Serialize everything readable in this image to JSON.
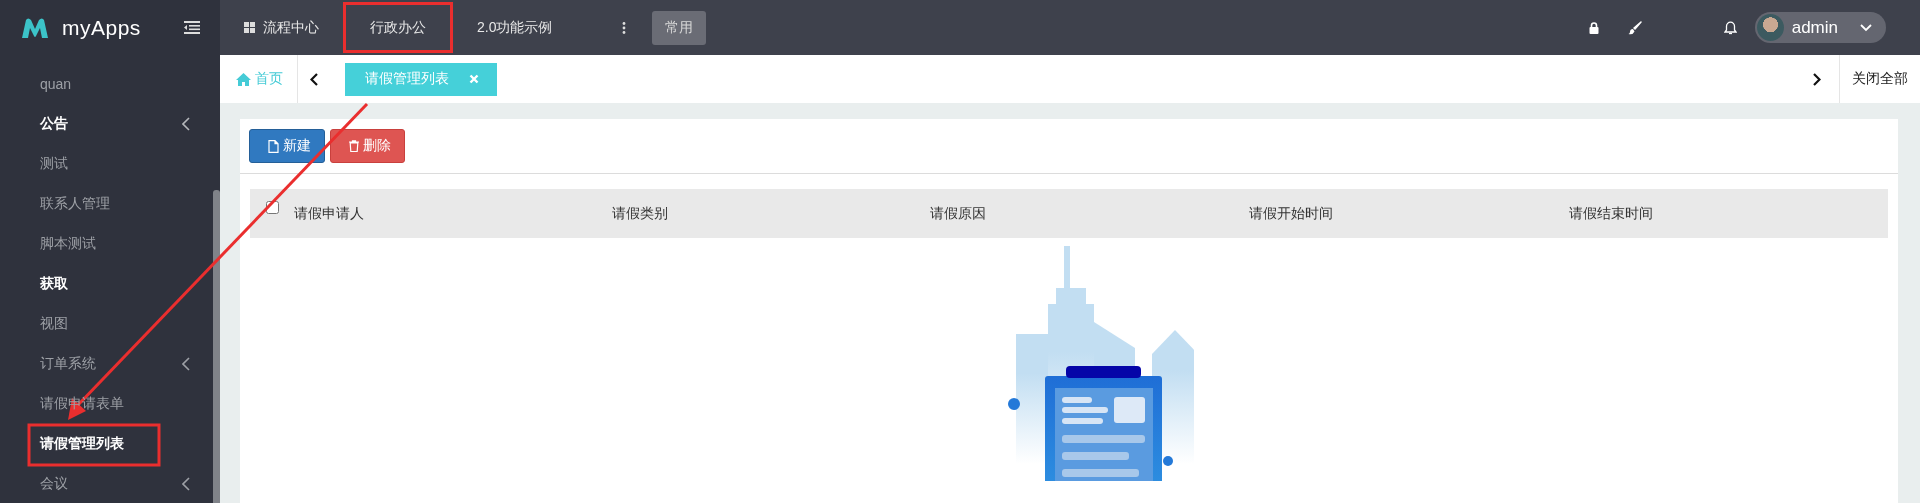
{
  "brand": {
    "name": "myApps"
  },
  "top_nav": [
    {
      "label": "流程中心",
      "kind": "grid",
      "selected": false
    },
    {
      "label": "行政办公",
      "kind": "plain",
      "selected": true
    },
    {
      "label": "2.0功能示例",
      "kind": "plain",
      "selected": false
    }
  ],
  "common_button": "常用",
  "user": {
    "name": "admin"
  },
  "sidebar": {
    "items": [
      {
        "label": "quan",
        "kind": "item",
        "highlighted": false
      },
      {
        "label": "公告",
        "kind": "group",
        "highlighted": true
      },
      {
        "label": "测试",
        "kind": "item",
        "highlighted": false
      },
      {
        "label": "联系人管理",
        "kind": "item",
        "highlighted": false
      },
      {
        "label": "脚本测试",
        "kind": "item",
        "highlighted": false
      },
      {
        "label": "获取",
        "kind": "item",
        "highlighted": true
      },
      {
        "label": "视图",
        "kind": "item",
        "highlighted": false
      },
      {
        "label": "订单系统",
        "kind": "group",
        "highlighted": false
      },
      {
        "label": "请假申请表单",
        "kind": "item",
        "highlighted": false
      },
      {
        "label": "请假管理列表",
        "kind": "item",
        "highlighted": true
      },
      {
        "label": "会议",
        "kind": "group",
        "highlighted": false
      }
    ]
  },
  "tab_bar": {
    "home": "首页",
    "tabs": [
      {
        "label": "请假管理列表",
        "selected": true
      }
    ],
    "close_all": "关闭全部"
  },
  "toolbar": [
    {
      "label": "新建",
      "kind": "new"
    },
    {
      "label": "删除",
      "kind": "delete"
    }
  ],
  "table": {
    "select_all_checked": false,
    "columns": [
      "请假申请人",
      "请假类别",
      "请假原因",
      "请假开始时间",
      "请假结束时间"
    ]
  }
}
